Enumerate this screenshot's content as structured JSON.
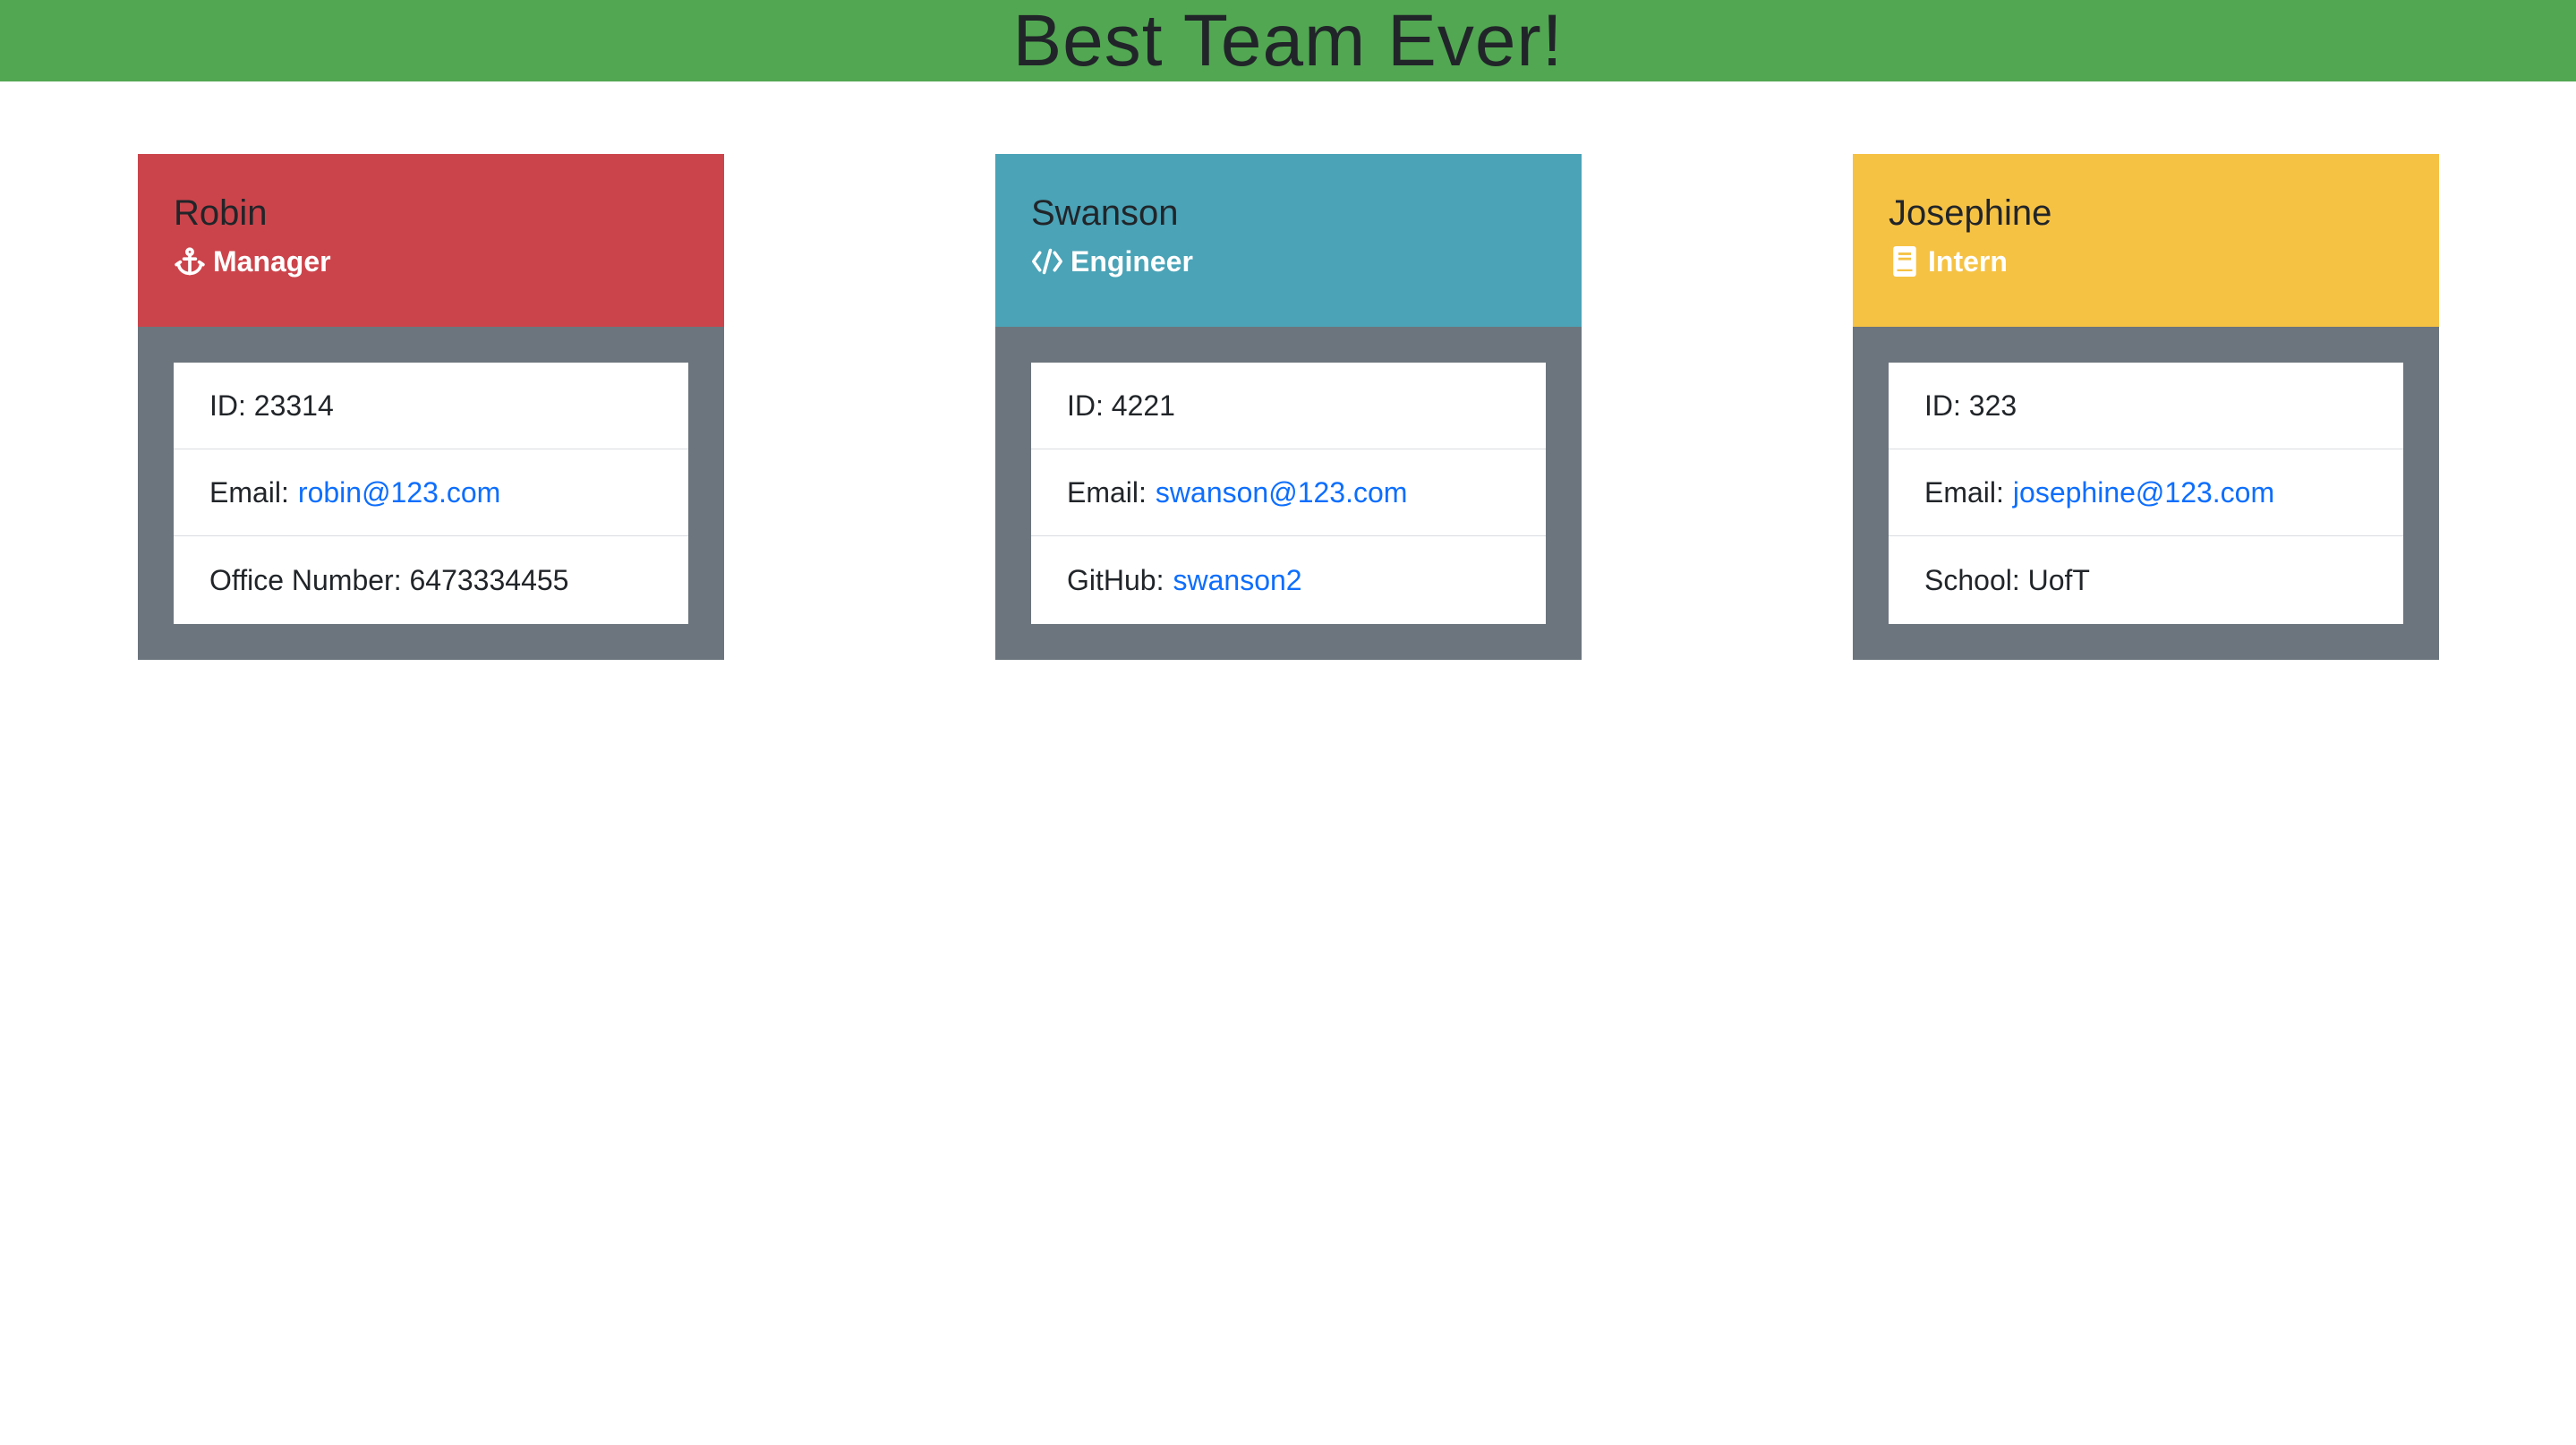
{
  "page": {
    "title": "Best Team Ever!",
    "header_color": "#52a752"
  },
  "colors": {
    "body_panel": "#6c757d",
    "link": "#0d6efd"
  },
  "employees": [
    {
      "name": "Robin",
      "role": "Manager",
      "role_icon": "anchor-icon",
      "color": "#cc444b",
      "id_label": "ID: 23314",
      "email_label": "Email:",
      "email": "robin@123.com",
      "extra_label": "Office Number: 6473334455",
      "extra_value": ""
    },
    {
      "name": "Swanson",
      "role": "Engineer",
      "role_icon": "code-icon",
      "color": "#4aa3b7",
      "id_label": "ID: 4221",
      "email_label": "Email:",
      "email": "swanson@123.com",
      "extra_label": "GitHub:",
      "extra_value": "swanson2"
    },
    {
      "name": "Josephine",
      "role": "Intern",
      "role_icon": "book-icon",
      "color": "#f6c244",
      "id_label": "ID: 323",
      "email_label": "Email:",
      "email": "josephine@123.com",
      "extra_label": "School: UofT",
      "extra_value": ""
    }
  ]
}
